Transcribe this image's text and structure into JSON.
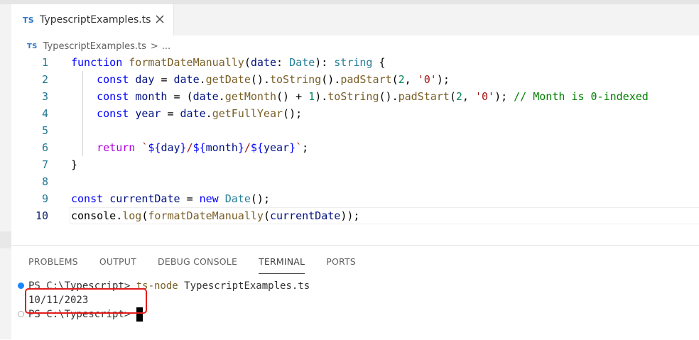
{
  "editor_tab": {
    "badge": "TS",
    "title": "TypescriptExamples.ts",
    "close_icon": "close-icon"
  },
  "breadcrumb": {
    "badge": "TS",
    "file": "TypescriptExamples.ts",
    "separator": ">",
    "more": "..."
  },
  "code": {
    "line_numbers": [
      "1",
      "2",
      "3",
      "4",
      "5",
      "6",
      "7",
      "8",
      "9",
      "10"
    ],
    "active_line": "10",
    "lines": [
      "function formatDateManually(date: Date): string {",
      "    const day = date.getDate().toString().padStart(2, '0');",
      "    const month = (date.getMonth() + 1).toString().padStart(2, '0'); // Month is 0-indexed",
      "    const year = date.getFullYear();",
      "",
      "    return `${day}/${month}/${year}`;",
      "}",
      "",
      "const currentDate = new Date();",
      "console.log(formatDateManually(currentDate));"
    ]
  },
  "panel": {
    "tabs": [
      {
        "label": "PROBLEMS"
      },
      {
        "label": "OUTPUT"
      },
      {
        "label": "DEBUG CONSOLE"
      },
      {
        "label": "TERMINAL",
        "active": true
      },
      {
        "label": "PORTS"
      }
    ]
  },
  "terminal": {
    "prompt1": "PS C:\\Typescript> ",
    "command": "ts-node",
    "args": " TypescriptExamples.ts",
    "output": "10/11/2023",
    "prompt2": "PS C:\\Typescript> "
  },
  "colors": {
    "keyword": "#0000ff",
    "function": "#795e26",
    "variable": "#001080",
    "type": "#267f99",
    "number": "#098658",
    "string": "#a31515",
    "comment": "#008000",
    "highlight_box": "#e31b1b",
    "ts_badge": "#3178c6"
  }
}
